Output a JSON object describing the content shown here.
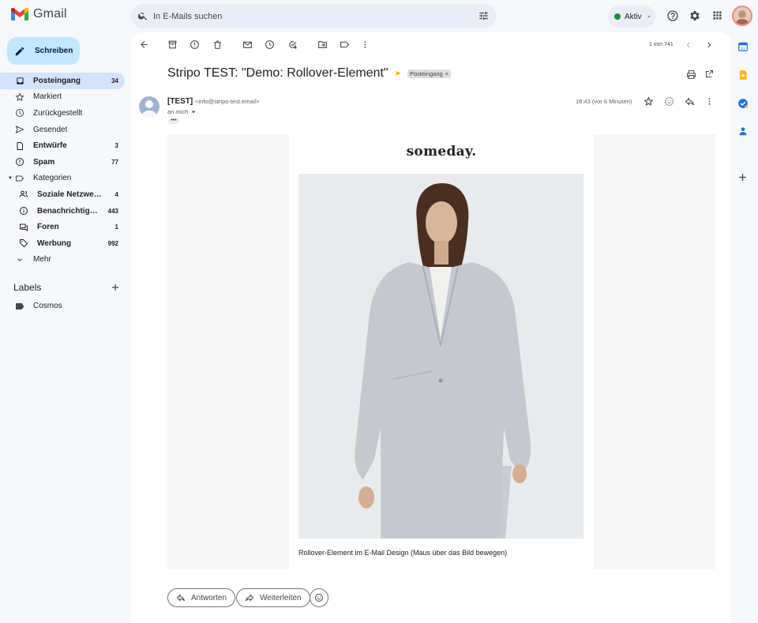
{
  "app": {
    "name": "Gmail",
    "search_placeholder": "In E-Mails suchen",
    "status_label": "Aktiv",
    "colors": {
      "accent": "#0b57d0",
      "active_nav": "#d3e3fd",
      "compose": "#c2e7ff",
      "status_dot": "#1e8e3e",
      "important": "#f5b400"
    }
  },
  "sidebar": {
    "compose_label": "Schreiben",
    "items": [
      {
        "label": "Posteingang",
        "count": "34",
        "icon": "inbox-icon"
      },
      {
        "label": "Markiert",
        "count": "",
        "icon": "star-icon"
      },
      {
        "label": "Zurückgestellt",
        "count": "",
        "icon": "clock-icon"
      },
      {
        "label": "Gesendet",
        "count": "",
        "icon": "send-icon"
      },
      {
        "label": "Entwürfe",
        "count": "3",
        "icon": "draft-icon"
      },
      {
        "label": "Spam",
        "count": "77",
        "icon": "spam-icon"
      },
      {
        "label": "Kategorien",
        "count": "",
        "icon": "label-icon"
      },
      {
        "label": "Soziale Netzwerke",
        "count": "4",
        "icon": "people-icon"
      },
      {
        "label": "Benachrichtigungen",
        "count": "443",
        "icon": "info-icon"
      },
      {
        "label": "Foren",
        "count": "1",
        "icon": "forum-icon"
      },
      {
        "label": "Werbung",
        "count": "992",
        "icon": "tag-icon"
      },
      {
        "label": "Mehr",
        "count": "",
        "icon": "chevron-down-icon"
      }
    ],
    "labels_heading": "Labels",
    "labels": [
      {
        "label": "Cosmos"
      }
    ]
  },
  "toolbar": {
    "pager": "1 von 741"
  },
  "message": {
    "subject": "Stripo TEST: \"Demo: Rollover-Element\"",
    "inbox_chip": "Posteingang",
    "sender_name": "[TEST]",
    "sender_email": "<info@stripo-test.email>",
    "to": "an mich",
    "time": "18:43 (vor 6 Minuten)",
    "body": {
      "brand": "someday.",
      "caption": "Rollover-Element im E-Mail Design (Maus über das Bild bewegen)"
    }
  },
  "actions": {
    "reply": "Antworten",
    "forward": "Weiterleiten"
  }
}
